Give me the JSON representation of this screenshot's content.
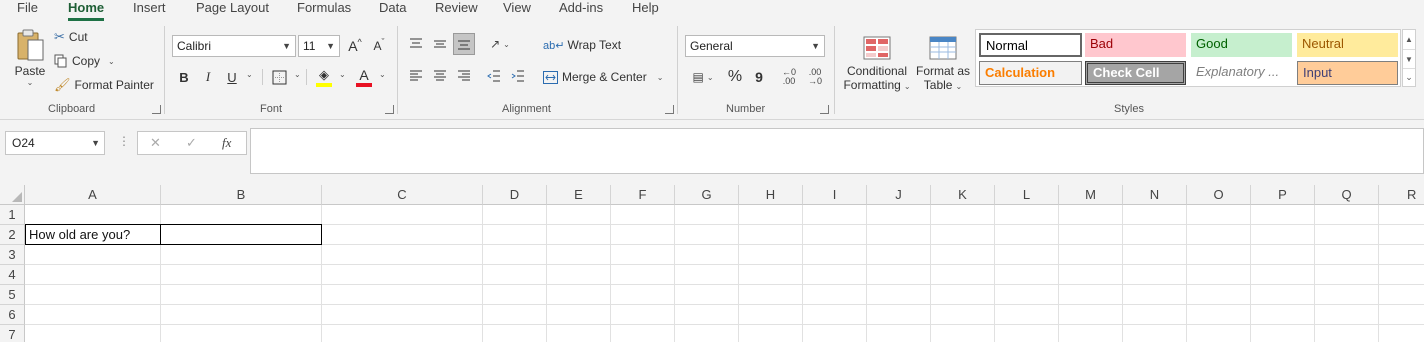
{
  "menu": {
    "tabs": [
      {
        "label": "File"
      },
      {
        "label": "Home"
      },
      {
        "label": "Insert"
      },
      {
        "label": "Page Layout"
      },
      {
        "label": "Formulas"
      },
      {
        "label": "Data"
      },
      {
        "label": "Review"
      },
      {
        "label": "View"
      },
      {
        "label": "Add-ins"
      },
      {
        "label": "Help"
      }
    ],
    "active": "Home"
  },
  "clipboard": {
    "paste_label": "Paste",
    "cut_label": "Cut",
    "copy_label": "Copy",
    "format_painter_label": "Format Painter",
    "group_label": "Clipboard"
  },
  "font": {
    "font_name": "Calibri",
    "font_size": "11",
    "grow_label": "A",
    "shrink_label": "A",
    "bold": "B",
    "italic": "I",
    "underline": "U",
    "group_label": "Font",
    "font_color": "#e81123",
    "highlight_color": "#ffff00"
  },
  "alignment": {
    "wrap_text_label": "Wrap Text",
    "merge_center_label": "Merge & Center",
    "group_label": "Alignment"
  },
  "number": {
    "format_value": "General",
    "percent": "%",
    "comma": "9",
    "group_label": "Number"
  },
  "styles": {
    "conditional_line1": "Conditional",
    "conditional_line2": "Formatting",
    "format_table_line1": "Format as",
    "format_table_line2": "Table",
    "group_label": "Styles",
    "cells": [
      {
        "label": "Normal",
        "bg": "#ffffff",
        "color": "#000000"
      },
      {
        "label": "Bad",
        "bg": "#ffc7ce",
        "color": "#9c0006"
      },
      {
        "label": "Good",
        "bg": "#c6efce",
        "color": "#006100"
      },
      {
        "label": "Neutral",
        "bg": "#ffeb9c",
        "color": "#9c5700"
      },
      {
        "label": "Calculation",
        "bg": "#f2f2f2",
        "color": "#fa7d00"
      },
      {
        "label": "Check Cell",
        "bg": "#a5a5a5",
        "color": "#ffffff"
      },
      {
        "label": "Explanatory ...",
        "bg": "#ffffff",
        "color": "#7f7f7f"
      },
      {
        "label": "Input",
        "bg": "#ffcc99",
        "color": "#3f3f76"
      }
    ]
  },
  "formula_bar": {
    "name_box": "O24",
    "cancel": "✕",
    "enter": "✓",
    "fx": "fx",
    "formula": ""
  },
  "sheet": {
    "columns": [
      "A",
      "B",
      "C",
      "D",
      "E",
      "F",
      "G",
      "H",
      "I",
      "J",
      "K",
      "L",
      "M",
      "N",
      "O",
      "P",
      "Q",
      "R"
    ],
    "rows": [
      "1",
      "2",
      "3",
      "4",
      "5",
      "6",
      "7"
    ],
    "cells": {
      "A2": "How old are you?"
    },
    "selected_range_border": "B2"
  }
}
